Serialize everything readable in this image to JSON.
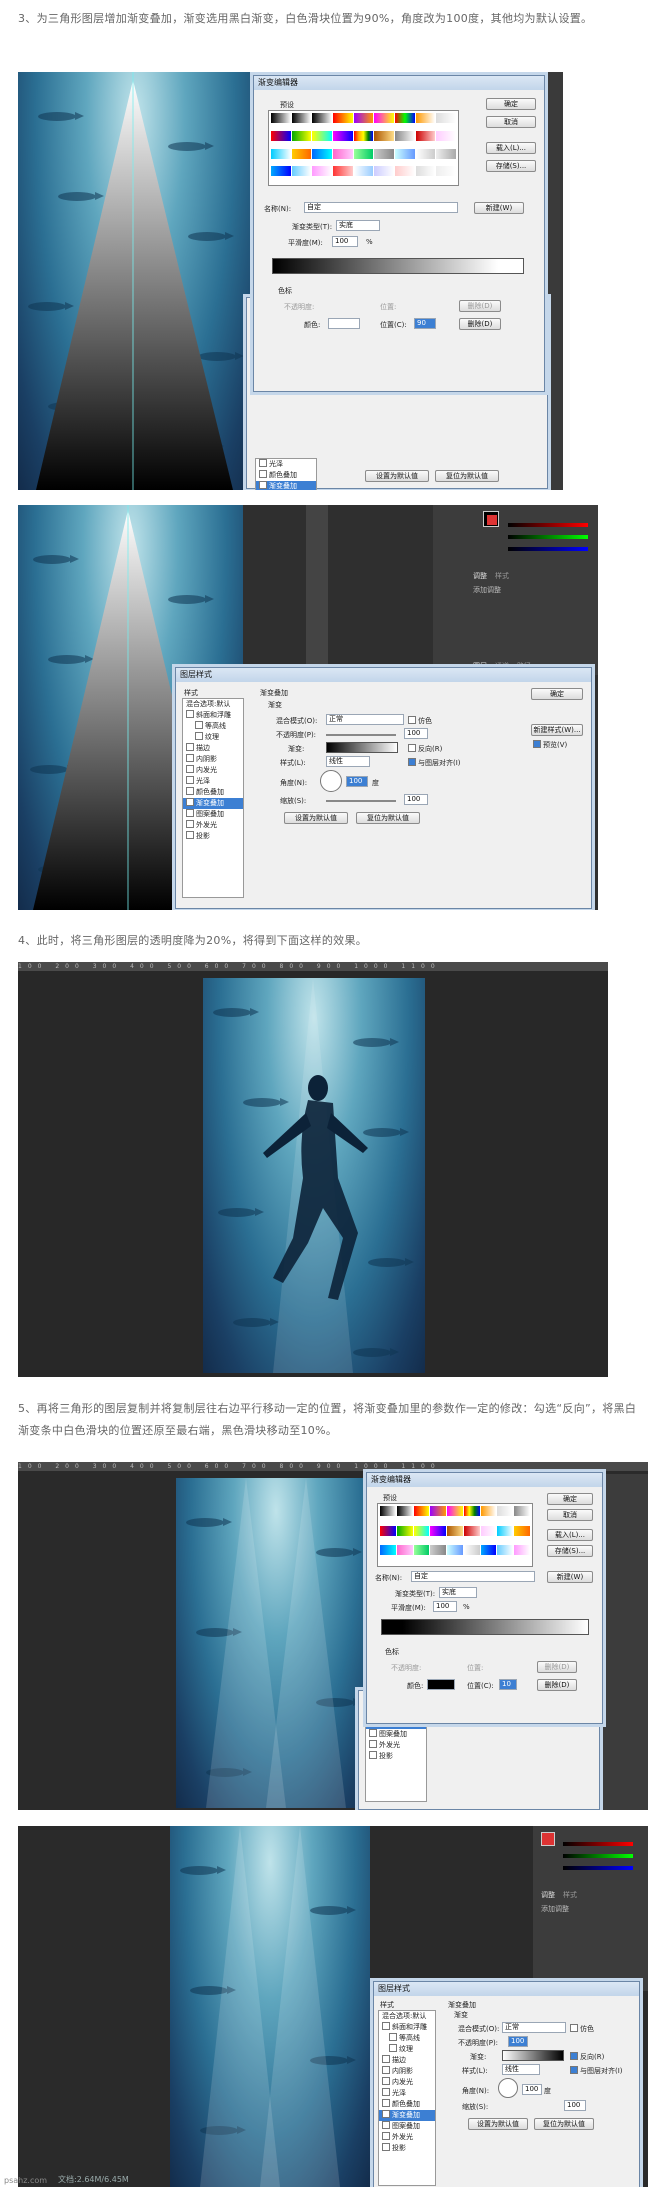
{
  "step3_text": "3、为三角形图层增加渐变叠加，渐变选用黑白渐变，白色滑块位置为90%，角度改为100度，其他均为默认设置。",
  "step4_text": "4、此时，将三角形图层的透明度降为20%，将得到下面这样的效果。",
  "step5_text": "5、再将三角形的图层复制并将复制层往右边平行移动一定的位置，将渐变叠加里的参数作一定的修改：勾选“反向”，将黑白渐变条中白色滑块的位置还原至最右端，黑色滑块移动至10%。",
  "gradient_editor": {
    "title": "渐变编辑器",
    "presets_label": "预设",
    "ok": "确定",
    "cancel": "取消",
    "load": "载入(L)...",
    "save": "存储(S)...",
    "name_label": "名称(N):",
    "name_value": "自定",
    "new_button": "新建(W)",
    "type_label": "渐变类型(T):",
    "type_value": "实底",
    "smooth_label": "平滑度(M):",
    "smooth_value": "100",
    "smooth_unit": "%",
    "stops_label": "色标",
    "opacity_label": "不透明度:",
    "location_label": "位置:",
    "delete_label": "删除(D)",
    "color_label": "颜色:",
    "location_c_label": "位置(C):",
    "location_value_1": "90",
    "location_value_2": "10"
  },
  "layer_style": {
    "title": "图层样式",
    "styles_label": "样式",
    "blend_default": "混合选项:默认",
    "items": [
      "斜面和浮雕",
      "等高线",
      "纹理",
      "描边",
      "内阴影",
      "内发光",
      "光泽",
      "颜色叠加",
      "渐变叠加",
      "图案叠加",
      "外发光",
      "投影"
    ],
    "selected_item": "渐变叠加",
    "section_title": "渐变叠加",
    "section_sub": "渐变",
    "blend_mode_label": "混合模式(O):",
    "blend_mode_value": "正常",
    "dither_label": "仿色",
    "opacity_label": "不透明度(P):",
    "opacity_value": "100",
    "gradient_label": "渐变:",
    "reverse_label": "反向(R)",
    "style_label": "样式(L):",
    "style_value": "线性",
    "align_label": "与图层对齐(I)",
    "angle_label": "角度(N):",
    "angle_value": "100",
    "angle_unit": "度",
    "scale_label": "缩放(S):",
    "scale_value": "100",
    "set_default": "设置为默认值",
    "reset_default": "复位为默认值",
    "ok": "确定",
    "new_style": "新建样式(W)...",
    "preview": "预览(V)"
  },
  "panel_texts": {
    "adjust_tab": "调整",
    "styles_tab": "样式",
    "add_adjust": "添加调整",
    "layers_tab": "图层",
    "channels_tab": "通道",
    "paths_tab": "路径"
  },
  "ruler_numbers": "100 200 300 400 500 600 700 800 900 1000 1100",
  "doc_status": "文档:2.64M/6.45M",
  "watermark": "psahz.com",
  "colors": {
    "accent": "#3c7fd3",
    "ps_bg": "#2b2b2b",
    "sea_dark": "#132c4b"
  }
}
